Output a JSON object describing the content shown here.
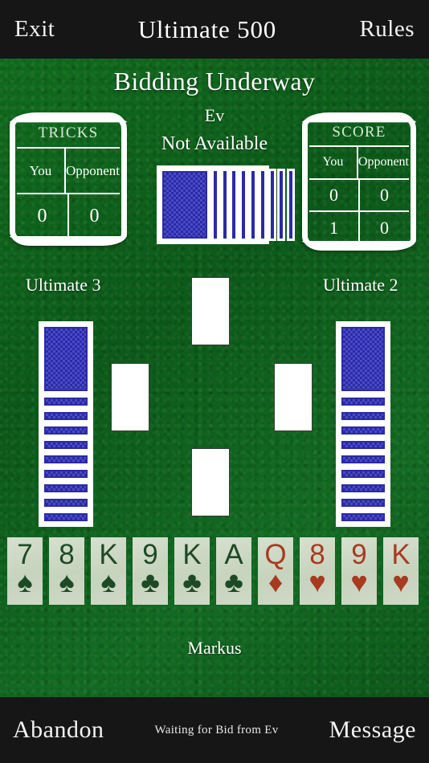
{
  "app": {
    "title": "Ultimate 500"
  },
  "topbar": {
    "exit_label": "Exit",
    "title": "Ultimate 500",
    "rules_label": "Rules"
  },
  "table": {
    "status_headline": "Bidding Underway",
    "current_bidder": "Ev",
    "current_bid": "Not Available",
    "felt_color": "#0f6320"
  },
  "tricks_panel": {
    "title": "TRICKS",
    "columns": [
      "You",
      "Opponent"
    ],
    "values": [
      "0",
      "0"
    ]
  },
  "score_panel": {
    "title": "SCORE",
    "columns": [
      "You",
      "Opponent"
    ],
    "rows": [
      [
        "0",
        "0"
      ],
      [
        "1",
        "0"
      ]
    ]
  },
  "deck": {
    "card_count": 10,
    "back_color": "#4a4ac8"
  },
  "seats": {
    "west": {
      "label": "Ultimate 3",
      "card_count": 10
    },
    "east": {
      "label": "Ultimate 2",
      "card_count": 10
    },
    "south": {
      "label": "Markus"
    }
  },
  "trick_slots": [
    {
      "name": "north",
      "card": ""
    },
    {
      "name": "west",
      "card": ""
    },
    {
      "name": "east",
      "card": ""
    },
    {
      "name": "south",
      "card": ""
    }
  ],
  "player_hand": {
    "cards": [
      {
        "rank": "7",
        "suit": "♠",
        "color": "black"
      },
      {
        "rank": "8",
        "suit": "♠",
        "color": "black"
      },
      {
        "rank": "K",
        "suit": "♠",
        "color": "black"
      },
      {
        "rank": "9",
        "suit": "♣",
        "color": "black"
      },
      {
        "rank": "K",
        "suit": "♣",
        "color": "black"
      },
      {
        "rank": "A",
        "suit": "♣",
        "color": "black"
      },
      {
        "rank": "Q",
        "suit": "♦",
        "color": "red"
      },
      {
        "rank": "8",
        "suit": "♥",
        "color": "red"
      },
      {
        "rank": "9",
        "suit": "♥",
        "color": "red"
      },
      {
        "rank": "K",
        "suit": "♥",
        "color": "red"
      }
    ],
    "black_color": "#1c4a24",
    "red_color": "#a83a20"
  },
  "bottombar": {
    "abandon_label": "Abandon",
    "status": "Waiting for Bid from Ev",
    "message_label": "Message"
  }
}
